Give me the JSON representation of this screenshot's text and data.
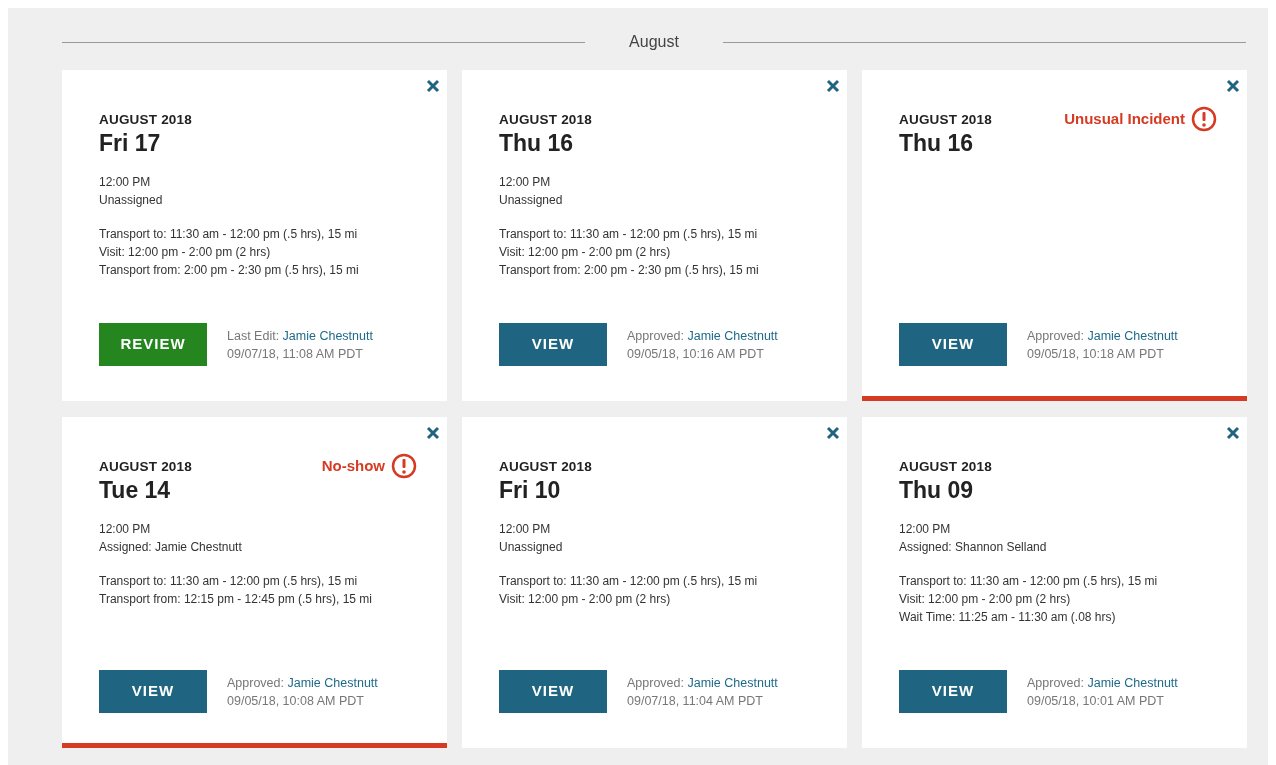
{
  "section_title": "August",
  "cards": [
    {
      "month": "AUGUST 2018",
      "day": "Fri 17",
      "time": "12:00 PM",
      "assignee": "Unassigned",
      "segments": [
        "Transport to: 11:30 am - 12:00 pm (.5 hrs), 15 mi",
        "Visit: 12:00 pm - 2:00 pm (2 hrs)",
        "Transport from: 2:00 pm - 2:30 pm (.5 hrs), 15 mi"
      ],
      "button": {
        "label": "REVIEW",
        "kind": "review"
      },
      "status_label": "Last Edit:",
      "status_name": "Jamie Chestnutt",
      "status_date": "09/07/18, 11:08 AM PDT"
    },
    {
      "month": "AUGUST 2018",
      "day": "Thu 16",
      "time": "12:00 PM",
      "assignee": "Unassigned",
      "segments": [
        "Transport to: 11:30 am - 12:00 pm (.5 hrs), 15 mi",
        "Visit: 12:00 pm - 2:00 pm (2 hrs)",
        "Transport from: 2:00 pm - 2:30 pm (.5 hrs), 15 mi"
      ],
      "button": {
        "label": "VIEW",
        "kind": "view"
      },
      "status_label": "Approved:",
      "status_name": "Jamie Chestnutt",
      "status_date": "09/05/18, 10:16 AM PDT"
    },
    {
      "month": "AUGUST 2018",
      "day": "Thu 16",
      "alert": "Unusual Incident",
      "button": {
        "label": "VIEW",
        "kind": "view"
      },
      "status_label": "Approved:",
      "status_name": "Jamie Chestnutt",
      "status_date": "09/05/18, 10:18 AM PDT"
    },
    {
      "month": "AUGUST 2018",
      "day": "Tue 14",
      "alert": "No-show",
      "time": "12:00 PM",
      "assignee": "Assigned: Jamie Chestnutt",
      "segments": [
        "Transport to: 11:30 am - 12:00 pm (.5 hrs), 15 mi",
        "Transport from: 12:15 pm - 12:45 pm (.5 hrs), 15 mi"
      ],
      "button": {
        "label": "VIEW",
        "kind": "view"
      },
      "status_label": "Approved:",
      "status_name": "Jamie Chestnutt",
      "status_date": "09/05/18, 10:08 AM PDT"
    },
    {
      "month": "AUGUST 2018",
      "day": "Fri 10",
      "time": "12:00 PM",
      "assignee": "Unassigned",
      "segments": [
        "Transport to: 11:30 am - 12:00 pm (.5 hrs), 15 mi",
        "Visit: 12:00 pm - 2:00 pm (2 hrs)"
      ],
      "button": {
        "label": "VIEW",
        "kind": "view"
      },
      "status_label": "Approved:",
      "status_name": "Jamie Chestnutt",
      "status_date": "09/07/18, 11:04 AM PDT"
    },
    {
      "month": "AUGUST 2018",
      "day": "Thu 09",
      "time": "12:00 PM",
      "assignee": "Assigned: Shannon Selland",
      "segments": [
        "Transport to: 11:30 am - 12:00 pm (.5 hrs), 15 mi",
        "Visit: 12:00 pm - 2:00 pm (2 hrs)",
        "Wait Time: 11:25 am - 11:30 am (.08 hrs)"
      ],
      "button": {
        "label": "VIEW",
        "kind": "view"
      },
      "status_label": "Approved:",
      "status_name": "Jamie Chestnutt",
      "status_date": "09/05/18, 10:01 AM PDT"
    }
  ]
}
